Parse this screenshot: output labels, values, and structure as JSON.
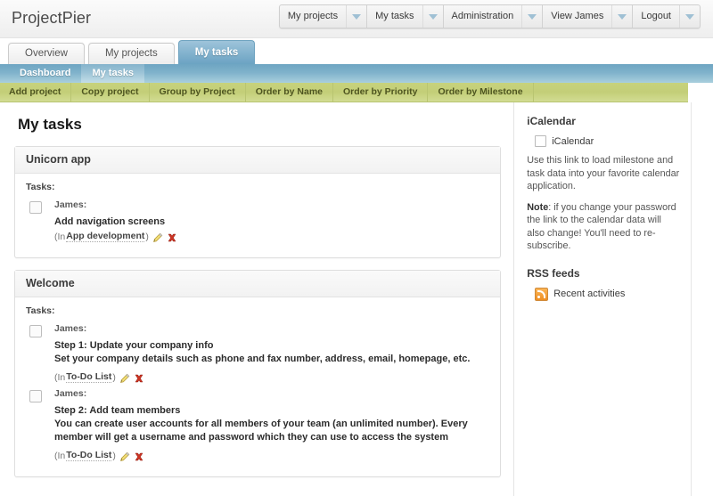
{
  "header": {
    "brand": "ProjectPier",
    "topnav": [
      {
        "label": "My projects",
        "icon": "chevron-down-icon"
      },
      {
        "label": "My tasks",
        "icon": "chevron-down-icon"
      },
      {
        "label": "Administration",
        "icon": "chevron-down-icon"
      },
      {
        "label": "View James",
        "icon": "chevron-down-icon"
      },
      {
        "label": "Logout",
        "icon": "chevron-down-icon"
      }
    ]
  },
  "tabs": [
    {
      "label": "Overview",
      "active": false
    },
    {
      "label": "My projects",
      "active": false
    },
    {
      "label": "My tasks",
      "active": true
    }
  ],
  "subnav": [
    {
      "label": "Dashboard",
      "active": false
    },
    {
      "label": "My tasks",
      "active": true
    }
  ],
  "toolbar": [
    {
      "label": "Add project"
    },
    {
      "label": "Copy project"
    },
    {
      "label": "Group by Project"
    },
    {
      "label": "Order by Name"
    },
    {
      "label": "Order by Priority"
    },
    {
      "label": "Order by Milestone"
    }
  ],
  "main": {
    "page_title": "My tasks",
    "tasks_label": "Tasks:",
    "panels": [
      {
        "title": "Unicorn app",
        "tasks_label": "Tasks:",
        "tasks": [
          {
            "assignee": "James:",
            "name": "Add navigation screens",
            "description": "",
            "meta_prefix": "(In ",
            "meta_link": "App development",
            "meta_suffix": ")",
            "edit_icon": "pencil-icon",
            "delete_icon": "delete-icon"
          }
        ]
      },
      {
        "title": "Welcome",
        "tasks_label": "Tasks:",
        "tasks": [
          {
            "assignee": "James:",
            "name": "Step 1: Update your company info",
            "description": "Set your company details such as phone and fax number, address, email, homepage, etc.",
            "meta_prefix": "(In ",
            "meta_link": "To-Do List",
            "meta_suffix": ")",
            "edit_icon": "pencil-icon",
            "delete_icon": "delete-icon"
          },
          {
            "assignee": "James:",
            "name": "Step 2: Add team members",
            "description": "You can create user accounts for all members of your team (an unlimited number). Every member will get a username and password which they can use to access the system",
            "meta_prefix": "(In ",
            "meta_link": "To-Do List",
            "meta_suffix": ")",
            "edit_icon": "pencil-icon",
            "delete_icon": "delete-icon"
          }
        ]
      }
    ]
  },
  "sidebar": {
    "icalendar_heading": "iCalendar",
    "icalendar_link": "iCalendar",
    "icalendar_text": "Use this link to load milestone and task data into your favorite calendar application.",
    "icalendar_note_label": "Note",
    "icalendar_note_text": ": if you change your password the link to the calendar data will also change! You'll need to re-subscribe.",
    "rss_heading": "RSS feeds",
    "rss_link": "Recent activities"
  },
  "colors": {
    "accent_blue": "#7fb0cc",
    "toolbar_green": "#c3ce78",
    "active_tab_text": "#ffffff",
    "link": "#444444",
    "delete_red": "#cc3322",
    "pencil_yellow": "#e8d26a",
    "rss_orange": "#ef8e22"
  }
}
